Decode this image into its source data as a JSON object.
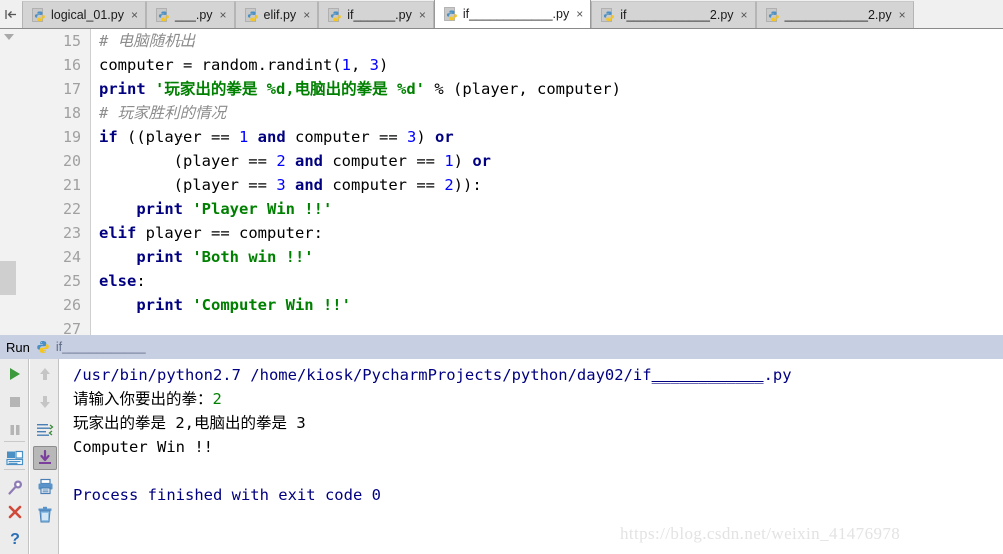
{
  "tabbar": {
    "pin_icon": "pin-left-icon",
    "tabs": [
      {
        "label": "logical_01.py",
        "active": false,
        "close": "×"
      },
      {
        "label": "___.py",
        "active": false,
        "close": "×"
      },
      {
        "label": "elif.py",
        "active": false,
        "close": "×"
      },
      {
        "label": "if______.py",
        "active": false,
        "close": "×"
      },
      {
        "label": "if____________.py",
        "active": true,
        "close": "×"
      },
      {
        "label": "if____________2.py",
        "active": false,
        "close": "×"
      },
      {
        "label": "____________2.py",
        "active": false,
        "close": "×"
      }
    ]
  },
  "editor": {
    "line_numbers": [
      "15",
      "16",
      "17",
      "18",
      "19",
      "20",
      "21",
      "22",
      "23",
      "24",
      "25",
      "26",
      "27"
    ],
    "lines": [
      {
        "n": "15",
        "segments": [
          {
            "t": "# 电脑随机出",
            "c": "cmt"
          }
        ]
      },
      {
        "n": "16",
        "segments": [
          {
            "t": "computer = random.randint(",
            "c": "plain"
          },
          {
            "t": "1",
            "c": "num"
          },
          {
            "t": ", ",
            "c": "plain"
          },
          {
            "t": "3",
            "c": "num"
          },
          {
            "t": ")",
            "c": "plain"
          }
        ]
      },
      {
        "n": "17",
        "segments": [
          {
            "t": "print ",
            "c": "kw"
          },
          {
            "t": "'玩家出的拳是 %d,电脑出的拳是 %d'",
            "c": "str"
          },
          {
            "t": " % (player, computer)",
            "c": "plain"
          }
        ]
      },
      {
        "n": "18",
        "segments": [
          {
            "t": "# 玩家胜利的情况",
            "c": "cmt"
          }
        ]
      },
      {
        "n": "19",
        "segments": [
          {
            "t": "if ",
            "c": "kw"
          },
          {
            "t": "((player == ",
            "c": "plain"
          },
          {
            "t": "1",
            "c": "num"
          },
          {
            "t": " and ",
            "c": "kw"
          },
          {
            "t": "computer == ",
            "c": "plain"
          },
          {
            "t": "3",
            "c": "num"
          },
          {
            "t": ") ",
            "c": "plain"
          },
          {
            "t": "or",
            "c": "kw"
          }
        ]
      },
      {
        "n": "20",
        "segments": [
          {
            "t": "        (player == ",
            "c": "plain"
          },
          {
            "t": "2",
            "c": "num"
          },
          {
            "t": " and ",
            "c": "kw"
          },
          {
            "t": "computer == ",
            "c": "plain"
          },
          {
            "t": "1",
            "c": "num"
          },
          {
            "t": ") ",
            "c": "plain"
          },
          {
            "t": "or",
            "c": "kw"
          }
        ]
      },
      {
        "n": "21",
        "segments": [
          {
            "t": "        (player == ",
            "c": "plain"
          },
          {
            "t": "3",
            "c": "num"
          },
          {
            "t": " and ",
            "c": "kw"
          },
          {
            "t": "computer == ",
            "c": "plain"
          },
          {
            "t": "2",
            "c": "num"
          },
          {
            "t": ")):",
            "c": "plain"
          }
        ]
      },
      {
        "n": "22",
        "segments": [
          {
            "t": "    print ",
            "c": "kw"
          },
          {
            "t": "'Player Win !!'",
            "c": "str"
          }
        ]
      },
      {
        "n": "23",
        "segments": [
          {
            "t": "elif ",
            "c": "kw"
          },
          {
            "t": "player == computer:",
            "c": "plain"
          }
        ]
      },
      {
        "n": "24",
        "segments": [
          {
            "t": "    print ",
            "c": "kw"
          },
          {
            "t": "'Both win !!'",
            "c": "str"
          }
        ]
      },
      {
        "n": "25",
        "segments": [
          {
            "t": "else",
            "c": "kw"
          },
          {
            "t": ":",
            "c": "plain"
          }
        ]
      },
      {
        "n": "26",
        "segments": [
          {
            "t": "    print ",
            "c": "kw"
          },
          {
            "t": "'Computer Win !!'",
            "c": "str"
          }
        ]
      }
    ]
  },
  "run_panel": {
    "title": "Run",
    "config_icon": "python-file-icon",
    "config_name": "if____________",
    "toolbar_left": [
      {
        "name": "run-button",
        "icon": "play-icon",
        "enabled": true
      },
      {
        "name": "stop-button",
        "icon": "stop-square-icon",
        "enabled": false
      },
      {
        "name": "pause-button",
        "icon": "pause-icon",
        "enabled": false
      },
      {
        "name": "restore-layout-button",
        "icon": "layout-icon",
        "enabled": true
      },
      {
        "name": "pin-tab-button",
        "icon": "pin-icon",
        "enabled": true
      },
      {
        "name": "close-button",
        "icon": "close-x-icon",
        "enabled": true
      },
      {
        "name": "help-button",
        "icon": "question-mark-icon",
        "enabled": true
      }
    ],
    "toolbar_right": [
      {
        "name": "up-button",
        "icon": "arrow-up-icon",
        "enabled": false
      },
      {
        "name": "down-button",
        "icon": "arrow-down-icon",
        "enabled": false
      },
      {
        "name": "soft-wrap-button",
        "icon": "soft-wrap-icon",
        "enabled": true
      },
      {
        "name": "scroll-to-end-button",
        "icon": "scroll-end-icon",
        "enabled": true,
        "pressed": true
      },
      {
        "name": "print-button",
        "icon": "printer-icon",
        "enabled": true
      },
      {
        "name": "clear-all-button",
        "icon": "trash-icon",
        "enabled": true
      }
    ],
    "console": [
      {
        "segments": [
          {
            "t": "/usr/bin/python2.7 /home/kiosk/PycharmProjects/python/day02/if",
            "c": "c-path"
          },
          {
            "t": "____________",
            "c": "c-path path-underline"
          },
          {
            "t": ".py",
            "c": "c-path"
          }
        ]
      },
      {
        "segments": [
          {
            "t": "请输入你要出的拳：",
            "c": "c-black"
          },
          {
            "t": "2",
            "c": "c-green"
          }
        ]
      },
      {
        "segments": [
          {
            "t": "玩家出的拳是 2,电脑出的拳是 3",
            "c": "c-black"
          }
        ]
      },
      {
        "segments": [
          {
            "t": "Computer Win !!",
            "c": "c-black"
          }
        ]
      },
      {
        "segments": [
          {
            "t": "",
            "c": "c-black"
          }
        ]
      },
      {
        "segments": [
          {
            "t": "Process finished with exit code 0",
            "c": "c-blue"
          }
        ]
      }
    ]
  },
  "watermark": {
    "text": "https://blog.csdn.net/weixin_41476978"
  },
  "colors": {
    "keyword": "#000080",
    "string": "#008000",
    "number": "#0000ff",
    "comment": "#8c8c8c",
    "run_header_bg": "#c7cfe2",
    "active_tab_bg": "#ffffff",
    "inactive_tab_bg": "#d4d4d4"
  }
}
